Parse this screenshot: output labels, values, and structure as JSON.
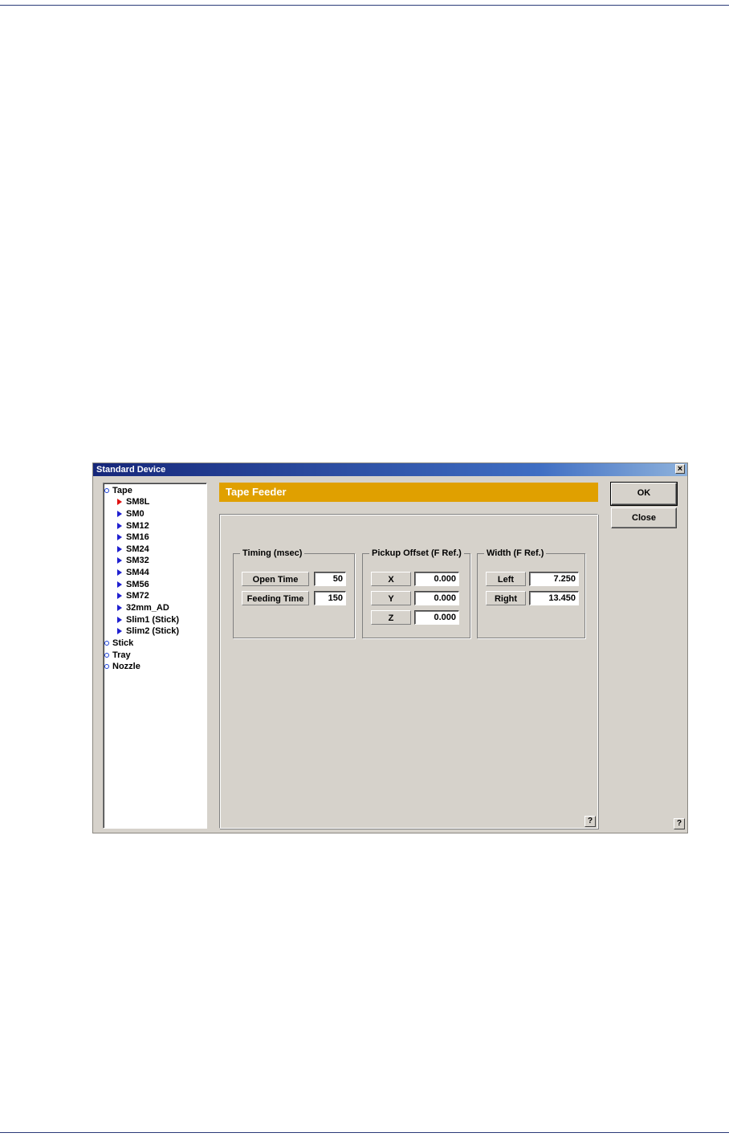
{
  "dialog": {
    "title": "Standard Device",
    "close_glyph": "×",
    "section_title": "Tape Feeder",
    "ok_label": "OK",
    "close_label": "Close",
    "help_glyph": "?"
  },
  "tree": {
    "items": [
      {
        "label": "Tape",
        "level": 0
      },
      {
        "label": "SM8L",
        "level": 1,
        "selected": true
      },
      {
        "label": "SM0",
        "level": 1
      },
      {
        "label": "SM12",
        "level": 1
      },
      {
        "label": "SM16",
        "level": 1
      },
      {
        "label": "SM24",
        "level": 1
      },
      {
        "label": "SM32",
        "level": 1
      },
      {
        "label": "SM44",
        "level": 1
      },
      {
        "label": "SM56",
        "level": 1
      },
      {
        "label": "SM72",
        "level": 1
      },
      {
        "label": "32mm_AD",
        "level": 1
      },
      {
        "label": "Slim1 (Stick)",
        "level": 1
      },
      {
        "label": "Slim2 (Stick)",
        "level": 1
      },
      {
        "label": "Stick",
        "level": 0
      },
      {
        "label": "Tray",
        "level": 0
      },
      {
        "label": "Nozzle",
        "level": 0
      }
    ]
  },
  "timing": {
    "title": "Timing (msec)",
    "open_time_label": "Open Time",
    "open_time_value": "50",
    "feeding_time_label": "Feeding Time",
    "feeding_time_value": "150"
  },
  "pickup_offset": {
    "title": "Pickup Offset (F Ref.)",
    "x_label": "X",
    "x_value": "0.000",
    "y_label": "Y",
    "y_value": "0.000",
    "z_label": "Z",
    "z_value": "0.000"
  },
  "width": {
    "title": "Width (F Ref.)",
    "left_label": "Left",
    "left_value": "7.250",
    "right_label": "Right",
    "right_value": "13.450"
  },
  "colors": {
    "titlebar_start": "#16277a",
    "section_header": "#e0a000",
    "dialog_bg": "#d6d2cb",
    "active_arrow": "#e01010",
    "arrow": "#1f1fd0"
  }
}
